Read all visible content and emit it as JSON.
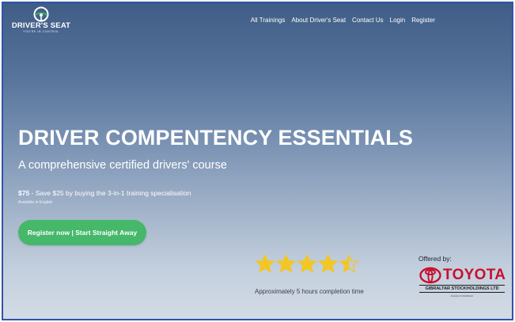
{
  "brand": {
    "name": "DRIVER'S SEAT",
    "tagline": "YOU'RE IN CONTROL"
  },
  "nav": {
    "items": [
      "All Trainings",
      "About Driver's Seat",
      "Contact Us",
      "Login",
      "Register"
    ]
  },
  "hero": {
    "title": "DRIVER COMPENTENCY ESSENTIALS",
    "subtitle": "A comprehensive certified drivers' course",
    "price": "$75",
    "price_detail": " - Save $25 by buying the 3-in-1 training specialisation",
    "language": "Available in English",
    "cta_label": "Register now | Start Straight Away"
  },
  "rating": {
    "stars": 4.5,
    "max_stars": 5,
    "completion_text": "Approximately 5 hours completion time"
  },
  "offered": {
    "label": "Offered by:",
    "brand_word": "TOYOTA",
    "company": "GIBRALTAR STOCKHOLDINGS LTD",
    "fine_print": "Importer & Distributor"
  },
  "colors": {
    "cta": "#45b86a",
    "star": "#f3c623",
    "toyota_red": "#c8102e",
    "frame": "#2f54a8"
  }
}
